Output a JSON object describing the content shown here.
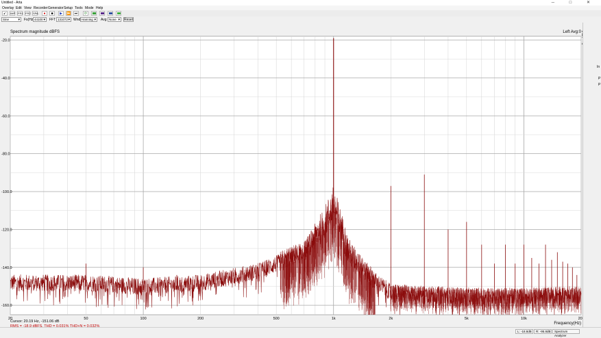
{
  "window": {
    "title": "Untitled - Arta",
    "controls": "─ □ ✕"
  },
  "menu": [
    "Overlay",
    "Edit",
    "View",
    "Recorder",
    "Generator",
    "Setup",
    "Tools",
    "Mode",
    "Help"
  ],
  "toolbar_icons": [
    "pointer-icon",
    "ir-icon",
    "fr-icon",
    "fr-icon",
    "step-icon",
    "record-icon",
    "stop-icon",
    "play-icon",
    "fast-forward-icon",
    "end-icon",
    "loop-icon",
    "green-rect-icon",
    "rect-icon",
    "rect-icon",
    "green-rect-icon"
  ],
  "toolbar_labels": [
    "",
    "IMP",
    "FR1",
    "FR2",
    "SPA",
    "",
    "",
    "",
    "",
    "",
    "",
    "",
    "",
    "",
    ""
  ],
  "controls": {
    "signal": "Sine",
    "fs_label": "Fs(Hz)",
    "fs_value": "44100",
    "fft_label": "FFT",
    "fft_value": "131072",
    "wnd_label": "Wnd",
    "wnd_value": "Hanning",
    "avg_label": "Avg",
    "avg_value": "None",
    "reset": "Reset"
  },
  "plot": {
    "title": "Spectrum magnitude dBFS",
    "status_right": "Left  Avg:0",
    "side_letters": [
      "A",
      "R",
      "T",
      "A"
    ],
    "cursor_text": "Cursor: 20.19 Hz, -151.06 dB",
    "measure_text": "RMS = -18.9 dBFS,   THD = 0.031%   THD+N = 0.032%",
    "trace_color": "#8b0d0d",
    "measure_color": "#c00000"
  },
  "chart_data": {
    "type": "line",
    "title": "Spectrum magnitude dBFS",
    "xlabel": "Frequency(Hz)",
    "ylabel": "",
    "xscale": "log",
    "xlim": [
      20,
      20000
    ],
    "ylim": [
      -165,
      -18
    ],
    "grid": true,
    "y_ticks": [
      "-20.0",
      "-40.0",
      "-60.0",
      "-80.0",
      "-100.0",
      "-120.0",
      "-140.0",
      "-160.0"
    ],
    "y_tick_values": [
      -20,
      -40,
      -60,
      -80,
      -100,
      -120,
      -140,
      -160
    ],
    "x_ticks": [
      "20",
      "50",
      "100",
      "200",
      "500",
      "1k",
      "2k",
      "5k",
      "10k",
      "20k"
    ],
    "x_tick_values": [
      20,
      50,
      100,
      200,
      500,
      1000,
      2000,
      5000,
      10000,
      20000
    ],
    "fundamental": {
      "x": 1000,
      "y": -19
    },
    "harmonic_peaks": [
      {
        "x": 50,
        "y": -138
      },
      {
        "x": 100,
        "y": -140
      },
      {
        "x": 150,
        "y": -144
      },
      {
        "x": 2000,
        "y": -97
      },
      {
        "x": 3000,
        "y": -91
      },
      {
        "x": 4000,
        "y": -120
      },
      {
        "x": 5000,
        "y": -116
      },
      {
        "x": 6000,
        "y": -128
      },
      {
        "x": 7000,
        "y": -138
      },
      {
        "x": 8000,
        "y": -128
      },
      {
        "x": 9000,
        "y": -138
      },
      {
        "x": 10000,
        "y": -128
      },
      {
        "x": 11000,
        "y": -135
      },
      {
        "x": 12000,
        "y": -138
      },
      {
        "x": 13000,
        "y": -128
      },
      {
        "x": 14000,
        "y": -136
      },
      {
        "x": 15000,
        "y": -132
      },
      {
        "x": 16000,
        "y": -137
      },
      {
        "x": 17000,
        "y": -138
      },
      {
        "x": 18000,
        "y": -140
      },
      {
        "x": 19000,
        "y": -144
      }
    ],
    "noise_floor_envelope": [
      {
        "x": 20,
        "y": -150
      },
      {
        "x": 50,
        "y": -150
      },
      {
        "x": 100,
        "y": -152
      },
      {
        "x": 200,
        "y": -150
      },
      {
        "x": 400,
        "y": -144
      },
      {
        "x": 700,
        "y": -134
      },
      {
        "x": 900,
        "y": -120
      },
      {
        "x": 1000,
        "y": -110
      },
      {
        "x": 1200,
        "y": -135
      },
      {
        "x": 1600,
        "y": -148
      },
      {
        "x": 2000,
        "y": -155
      },
      {
        "x": 5000,
        "y": -157
      },
      {
        "x": 10000,
        "y": -157
      },
      {
        "x": 20000,
        "y": -156
      }
    ]
  },
  "right_panel": [
    "In",
    "",
    "P",
    "",
    "P"
  ],
  "status": {
    "left": "L: -18.8dB",
    "right": "R: -95.8dB",
    "mode": "Spectrum Analyzer"
  }
}
